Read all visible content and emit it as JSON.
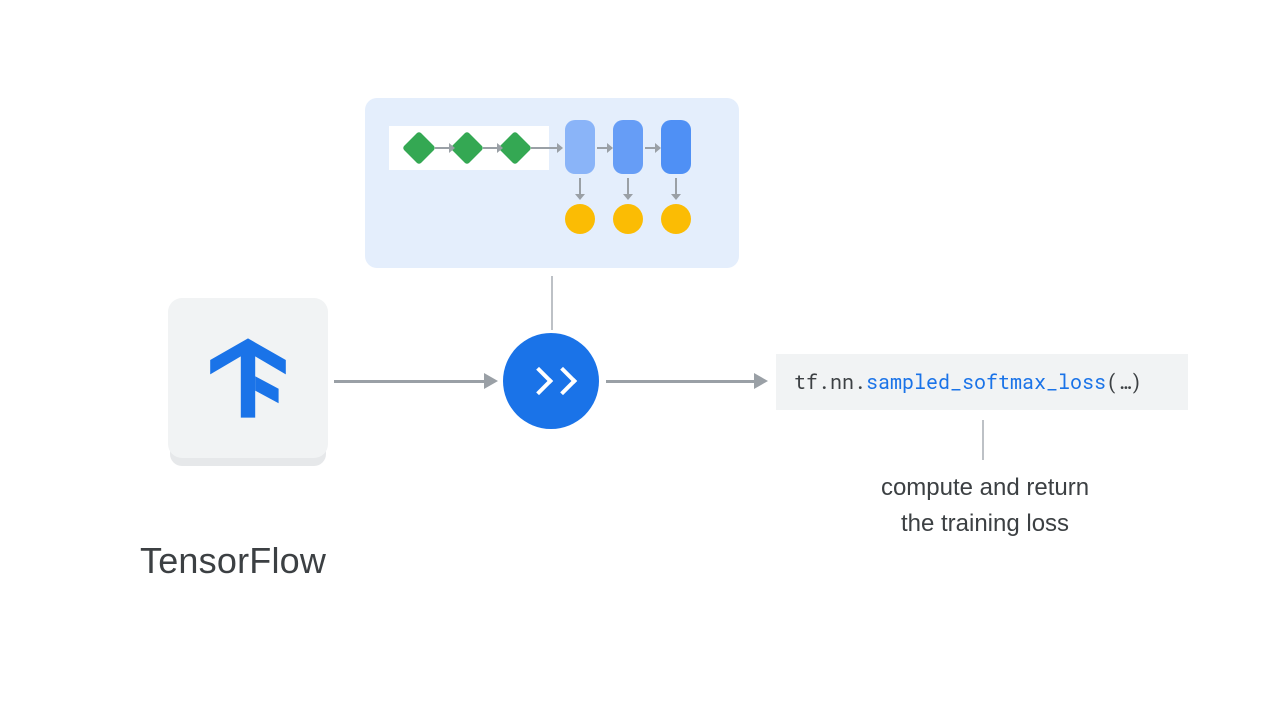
{
  "tensorflow_label": "TensorFlow",
  "code": {
    "prefix": "tf.nn.",
    "fn": "sampled_softmax_loss",
    "suffix": "(…)"
  },
  "caption_line1": "compute and return",
  "caption_line2": "the training loss",
  "colors": {
    "accent_blue": "#1a73e8",
    "panel_blue": "#e4eefc",
    "green": "#34a853",
    "yellow": "#fbbc04",
    "grey_panel": "#f1f3f4",
    "arrow_grey": "#9aa0a6"
  }
}
